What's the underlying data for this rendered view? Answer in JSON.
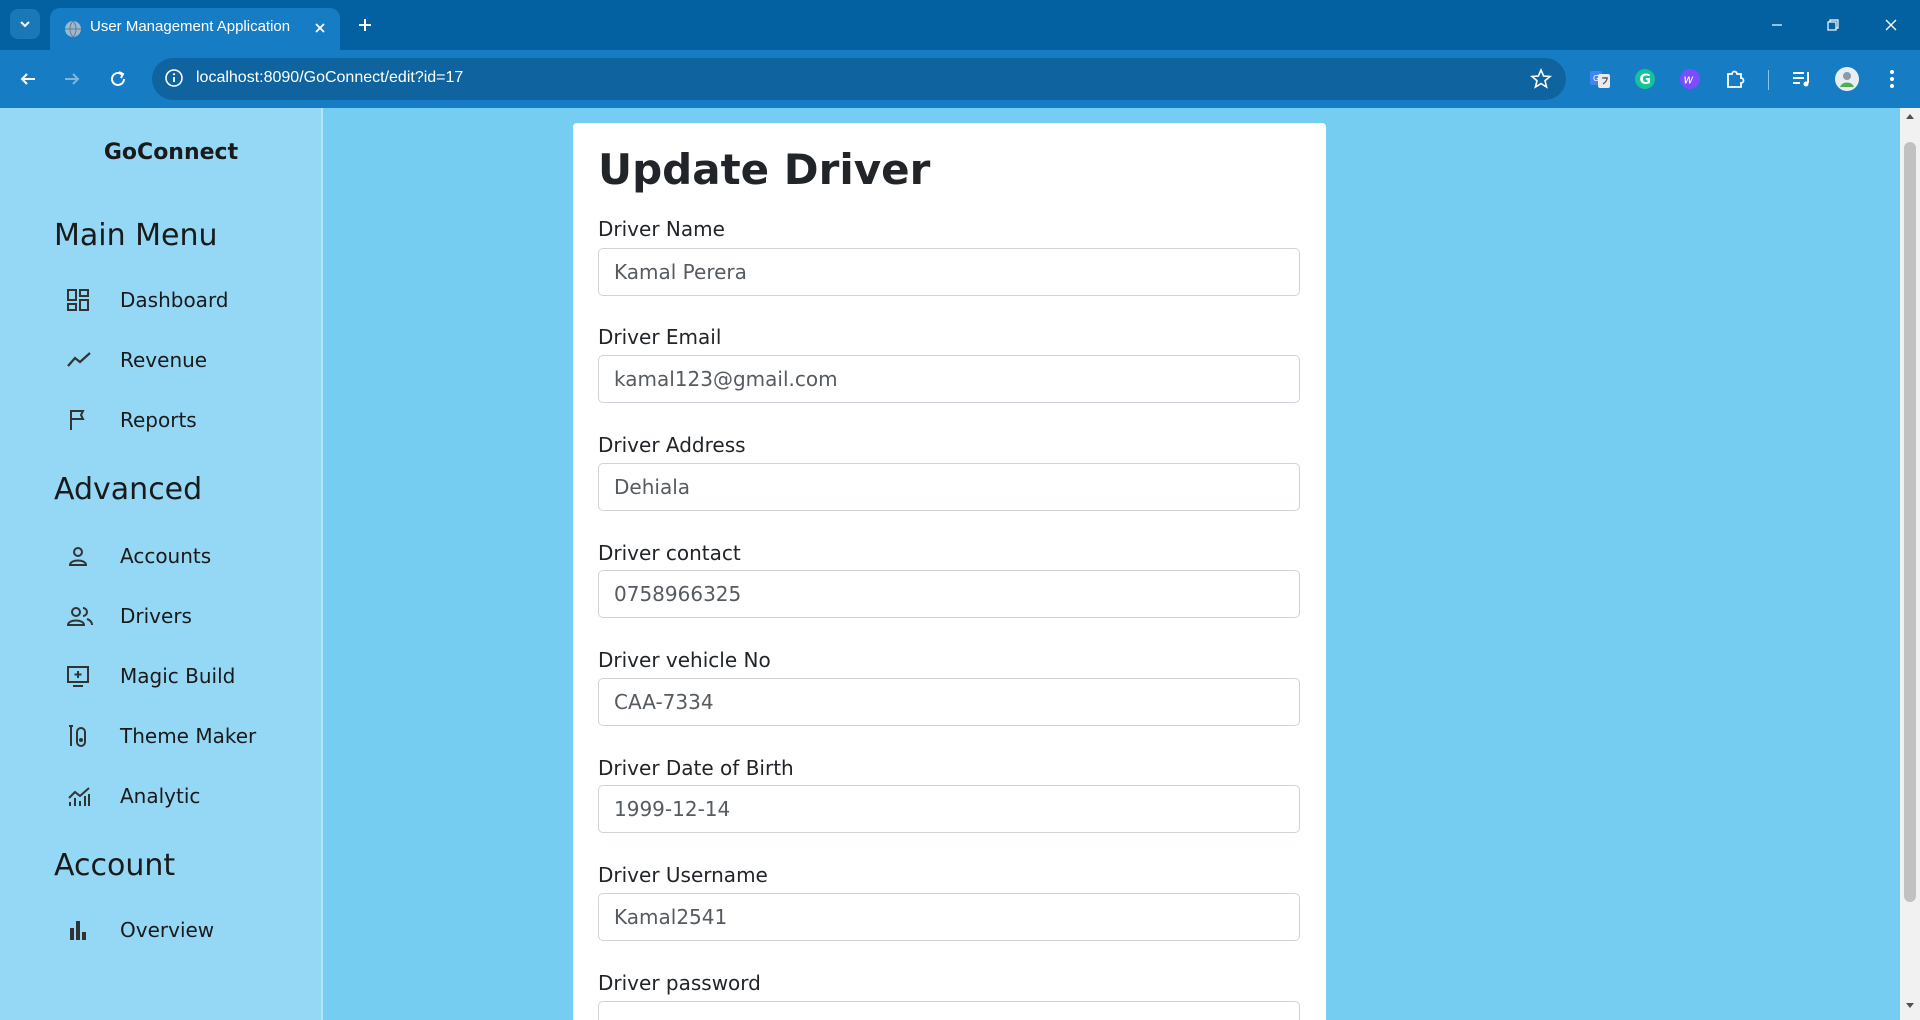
{
  "browser": {
    "tab_title": "User Management Application",
    "url": "localhost:8090/GoConnect/edit?id=17"
  },
  "sidebar": {
    "brand": "GoConnect",
    "sections": [
      {
        "title": "Main Menu",
        "items": [
          "Dashboard",
          "Revenue",
          "Reports"
        ]
      },
      {
        "title": "Advanced",
        "items": [
          "Accounts",
          "Drivers",
          "Magic Build",
          "Theme Maker",
          "Analytic"
        ]
      },
      {
        "title": "Account",
        "items": [
          "Overview"
        ]
      }
    ]
  },
  "form": {
    "title": "Update Driver",
    "fields": [
      {
        "label": "Driver Name",
        "value": "Kamal Perera"
      },
      {
        "label": "Driver Email",
        "value": "kamal123@gmail.com"
      },
      {
        "label": "Driver Address",
        "value": "Dehiala"
      },
      {
        "label": "Driver contact",
        "value": "0758966325"
      },
      {
        "label": "Driver vehicle No",
        "value": "CAA-7334"
      },
      {
        "label": "Driver Date of Birth",
        "value": "1999-12-14"
      },
      {
        "label": "Driver Username",
        "value": "Kamal2541"
      },
      {
        "label": "Driver password",
        "value": ""
      }
    ]
  },
  "colors": {
    "tabbar": "#0361a1",
    "toolbar": "#167cc3",
    "page_bg": "#75cdf2",
    "sidebar_bg": "#94d8f6",
    "card_bg": "#ffffff"
  }
}
